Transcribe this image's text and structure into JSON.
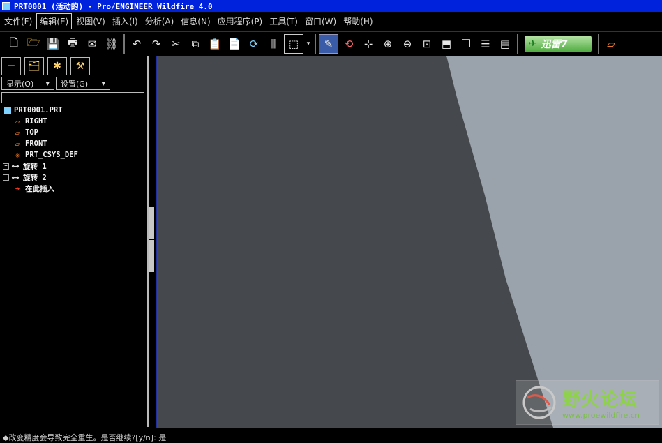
{
  "window": {
    "title": "PRT0001 (活动的) - Pro/ENGINEER Wildfire 4.0"
  },
  "menu": [
    {
      "label": "文件(F)"
    },
    {
      "label": "编辑(E)"
    },
    {
      "label": "视图(V)"
    },
    {
      "label": "插入(I)"
    },
    {
      "label": "分析(A)"
    },
    {
      "label": "信息(N)"
    },
    {
      "label": "应用程序(P)"
    },
    {
      "label": "工具(T)"
    },
    {
      "label": "窗口(W)"
    },
    {
      "label": "帮助(H)"
    }
  ],
  "toolbar": {
    "xunlei_label": "迅雷7"
  },
  "panel": {
    "show_dropdown": "显示(O)",
    "settings_dropdown": "设置(G)"
  },
  "tree": {
    "root": "PRT0001.PRT",
    "items": [
      {
        "label": "RIGHT",
        "icon": "datum-plane-icon"
      },
      {
        "label": "TOP",
        "icon": "datum-plane-icon"
      },
      {
        "label": "FRONT",
        "icon": "datum-plane-icon"
      },
      {
        "label": "PRT_CSYS_DEF",
        "icon": "coordinate-system-icon"
      },
      {
        "label": "旋转 1",
        "icon": "revolve-feature-icon"
      },
      {
        "label": "旋转 2",
        "icon": "revolve-feature-icon"
      },
      {
        "label": "在此插入",
        "icon": "insert-here-arrow-icon"
      }
    ]
  },
  "watermark": {
    "title": "野火论坛",
    "url": "www.proewildfire.cn"
  },
  "status": {
    "message": "◆改变精度会导致完全重生。是否继续?[y/n]: 是"
  },
  "colors": {
    "viewport_bg": "#45484c",
    "model_face": "#9aa3ab",
    "title_bar": "#0022dd"
  }
}
